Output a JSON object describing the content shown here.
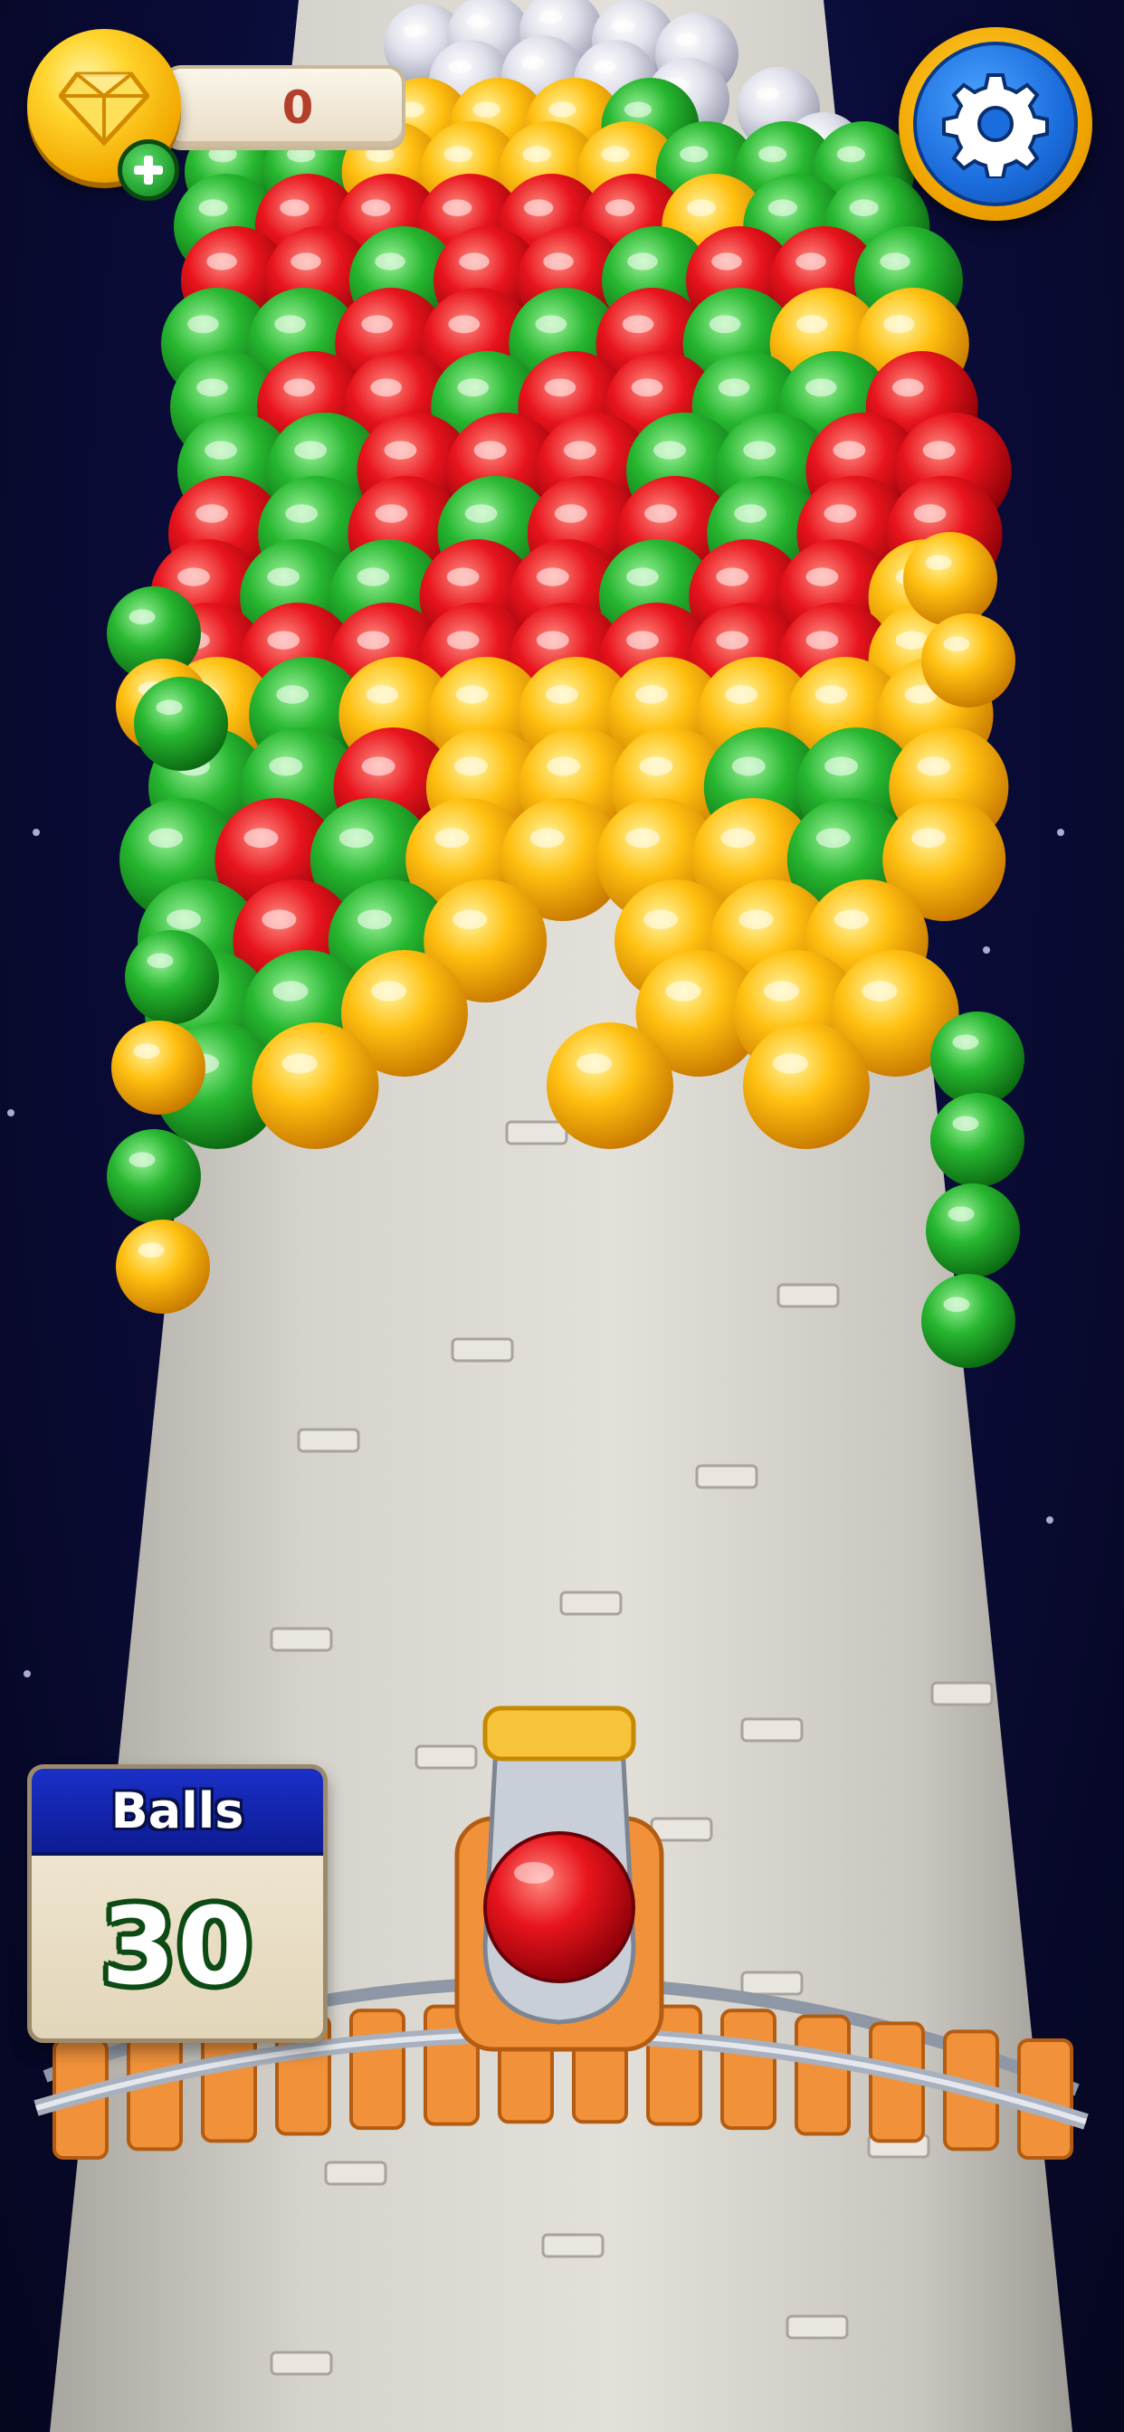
{
  "hud": {
    "coins": {
      "value": "0",
      "icon": "gem-coin-icon",
      "add_icon": "plus-icon"
    },
    "settings": {
      "icon": "gear-icon"
    },
    "balls": {
      "label": "Balls",
      "count": "30"
    }
  },
  "cannon": {
    "loaded_ball_color": "red"
  },
  "palette": {
    "red": "#e0141c",
    "green": "#22b52c",
    "yellow": "#f7b500",
    "white": "#e8e8ee",
    "tower": "#d8d5cf",
    "background": "#0a0c38",
    "ui_blue": "#1b6cdc",
    "ui_gold": "#f2a600"
  }
}
